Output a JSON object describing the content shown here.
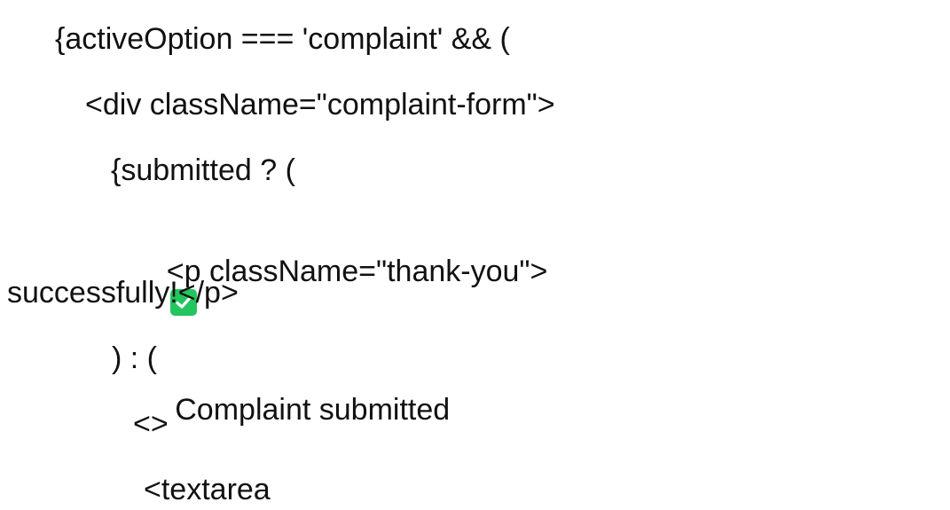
{
  "document": {
    "lines": {
      "l1": "{activeOption === 'complaint' && (",
      "l2": "<div className=\"complaint-form\">",
      "l3": "{submitted ? (",
      "l4a": "<p className=\"thank-you\">",
      "l4b": " Complaint submitted",
      "l5": "successfully!</p>",
      "l6": ") : (",
      "l7": "<>",
      "l8": "<textarea"
    },
    "icons": {
      "checkmark": "check-mark-button-emoji"
    },
    "colors": {
      "check_bg": "#22c55e",
      "text": "#111111"
    }
  }
}
